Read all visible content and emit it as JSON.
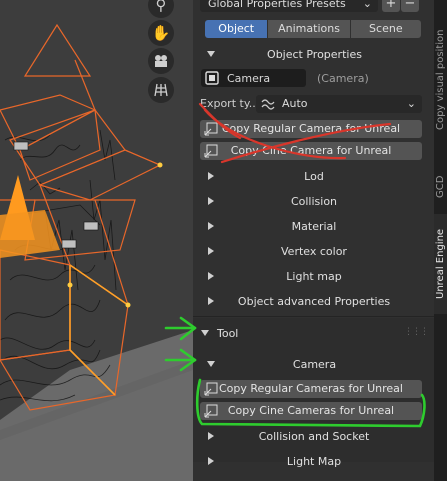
{
  "panel": {
    "presets_label": "Global Properties Presets",
    "add_label": "+",
    "remove_label": "−",
    "tabs": [
      {
        "label": "Object",
        "active": true
      },
      {
        "label": "Animations",
        "active": false
      },
      {
        "label": "Scene",
        "active": false
      }
    ],
    "object_properties": {
      "title": "Object Properties",
      "object_name": "Camera",
      "object_type": "(Camera)",
      "export_type_label": "Export ty...",
      "export_type_value": "Auto",
      "copy_regular_camera": "Copy Regular Camera for Unreal",
      "copy_cine_camera": "Copy Cine Camera for Unreal"
    },
    "collapsed_sections": [
      "Lod",
      "Collision",
      "Material",
      "Vertex color",
      "Light map",
      "Object advanced Properties"
    ],
    "tool": {
      "title": "Tool",
      "camera_title": "Camera",
      "copy_regular_cameras": "Copy Regular Cameras for Unreal",
      "copy_cine_cameras": "Copy Cine Cameras for Unreal",
      "collision_and_socket": "Collision and Socket",
      "light_map": "Light Map"
    }
  },
  "tabstrip": [
    {
      "label": "Copy visual position",
      "active": false
    },
    {
      "label": "GCD",
      "active": false
    },
    {
      "label": "Unreal Engine",
      "active": true
    }
  ],
  "colors": {
    "panel_bg": "#303030",
    "button_bg": "#545454",
    "active_tab": "#4772b3",
    "annotation_red": "#d9362b",
    "annotation_green": "#2ecc2e",
    "wire_orange": "#e8672a",
    "selected_orange": "#ffa028"
  },
  "icons": [
    "zoom-icon",
    "hand-pan-icon",
    "camera-view-icon",
    "grid-view-icon",
    "camera-icon",
    "wave-icon",
    "chevron-down-icon",
    "copy-camera-icon",
    "drag-handle-icon"
  ]
}
